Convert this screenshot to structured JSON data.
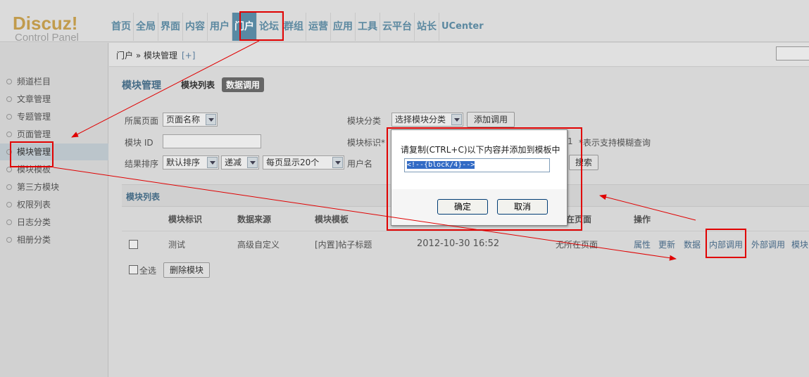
{
  "logo": {
    "main": "Discuz!",
    "sub": "Control Panel"
  },
  "nav": [
    {
      "label": "首页"
    },
    {
      "label": "全局"
    },
    {
      "label": "界面"
    },
    {
      "label": "内容"
    },
    {
      "label": "用户"
    },
    {
      "label": "门户",
      "active": true
    },
    {
      "label": "论坛"
    },
    {
      "label": "群组"
    },
    {
      "label": "运营"
    },
    {
      "label": "应用"
    },
    {
      "label": "工具"
    },
    {
      "label": "云平台"
    },
    {
      "label": "站长"
    },
    {
      "label": "UCenter"
    }
  ],
  "breadcrumb": {
    "text": "门户 » 模块管理",
    "add": "[+]"
  },
  "sidebar": [
    {
      "label": "频道栏目"
    },
    {
      "label": "文章管理"
    },
    {
      "label": "专题管理"
    },
    {
      "label": "页面管理"
    },
    {
      "label": "模块管理",
      "active": true
    },
    {
      "label": "模块模板"
    },
    {
      "label": "第三方模块"
    },
    {
      "label": "权限列表"
    },
    {
      "label": "日志分类"
    },
    {
      "label": "相册分类"
    }
  ],
  "main": {
    "title": "模块管理",
    "tabs": [
      "模块列表",
      "数据调用"
    ],
    "filters": {
      "page_label": "所属页面",
      "page_select": "页面名称",
      "category_label": "模块分类",
      "category_select": "选择模块分类",
      "add_call_button": "添加调用",
      "block_id_label": "模块 ID",
      "block_tag_label": "模块标识*",
      "fuzzy_hint_num": "1",
      "fuzzy_hint": "*表示支持模糊查询",
      "sort_label": "结果排序",
      "sort_select": "默认排序",
      "order_select": "递减",
      "per_page_select": "每页显示20个",
      "username_label": "用户名",
      "search_button": "搜索"
    },
    "list_title": "模块列表",
    "columns": [
      "模块标识",
      "数据来源",
      "模块模板",
      "在页面",
      "操作"
    ],
    "rows": [
      {
        "tag": "测试",
        "source": "高级自定义",
        "template": "[内置]帖子标题",
        "time": "2012-10-30 16:52",
        "page": "无所在页面",
        "ops": [
          "属性",
          "更新",
          "数据",
          "内部调用",
          "外部调用",
          "模块"
        ]
      }
    ],
    "select_all": "全选",
    "delete_button": "删除模块"
  },
  "dialog": {
    "message": "请复制(CTRL+C)以下内容并添加到模板中",
    "code": "<!--{block/4}-->",
    "ok": "确定",
    "cancel": "取消"
  },
  "annotation_color": "#e00000"
}
